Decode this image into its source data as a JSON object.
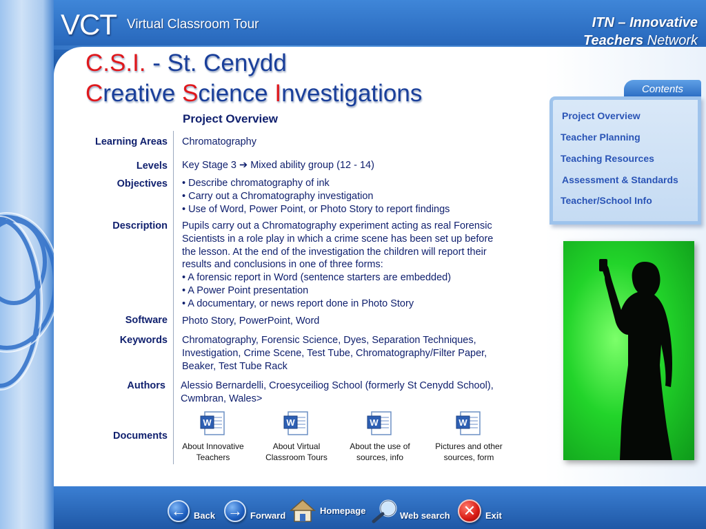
{
  "header": {
    "logo": "VCT",
    "subtitle": "Virtual Classroom Tour",
    "network_line1": "ITN – Innovative",
    "network_teachers": "Teachers",
    "network_word": "Network"
  },
  "title": {
    "line1_red": "C.S.I.",
    "line1_rest": " - St. Cenydd",
    "line2_c": "C",
    "line2_reative": "reative ",
    "line2_s": "S",
    "line2_cience": "cience ",
    "line2_i": "I",
    "line2_nvestigations": "nvestigations"
  },
  "overview_heading": "Project Overview",
  "rows": {
    "learning_areas": {
      "label": "Learning Areas",
      "value": "Chromatography"
    },
    "levels": {
      "label": "Levels",
      "value": "Key Stage 3 ➔ Mixed ability group (12 - 14)"
    },
    "objectives": {
      "label": "Objectives",
      "lines": [
        "• Describe chromatography of ink",
        "• Carry out a Chromatography investigation",
        "• Use of Word, Power Point, or Photo Story to report findings"
      ]
    },
    "description": {
      "label": "Description",
      "lines": [
        "Pupils carry out a Chromatography experiment acting as real Forensic",
        "Scientists in a role play in which a crime scene has been set up before",
        "the lesson. At the end of the investigation the children will report their",
        "results and conclusions in one of three forms:",
        "• A forensic report in Word (sentence starters are embedded)",
        "• A Power Point presentation",
        "• A documentary, or news report done in Photo Story"
      ]
    },
    "software": {
      "label": "Software",
      "value": "Photo Story, PowerPoint, Word"
    },
    "keywords": {
      "label": "Keywords",
      "lines": [
        "Chromatography, Forensic Science, Dyes, Separation Techniques,",
        "Investigation, Crime Scene, Test Tube, Chromatography/Filter Paper,",
        "Beaker, Test Tube Rack"
      ]
    },
    "authors": {
      "label": "Authors",
      "lines": [
        "Alessio Bernardelli, Croesyceiliog School (formerly St Cenydd School),",
        "Cwmbran, Wales>"
      ]
    },
    "documents": {
      "label": "Documents"
    }
  },
  "documents": [
    {
      "line1": "About Innovative",
      "line2": "Teachers"
    },
    {
      "line1": "About Virtual",
      "line2": "Classroom Tours"
    },
    {
      "line1": "About the use of",
      "line2": "sources, info"
    },
    {
      "line1": "Pictures and other",
      "line2": "sources, form"
    }
  ],
  "contents": {
    "tab": "Contents",
    "items": [
      "Project Overview",
      "Teacher Planning",
      "Teaching Resources",
      "Assessment & Standards",
      "Teacher/School Info"
    ]
  },
  "nav": {
    "back": "Back",
    "forward": "Forward",
    "homepage": "Homepage",
    "web_search": "Web search",
    "exit": "Exit"
  },
  "icons": {
    "back": "arrow-left-icon",
    "forward": "arrow-right-icon",
    "homepage": "house-icon",
    "web_search": "magnifier-icon",
    "exit": "close-icon",
    "document": "word-document-icon"
  },
  "colors": {
    "frame_blue": "#2b6cc0",
    "title_blue": "#1a3f9a",
    "title_red": "#e0181c",
    "text_navy": "#10206e",
    "contents_link": "#2a54b6",
    "photo_green": "#22d42a"
  }
}
